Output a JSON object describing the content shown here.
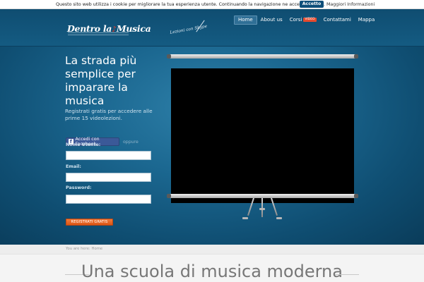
{
  "cookie_bar": {
    "message": "Questo sito web utilizza i cookie per migliorare la tua esperienza utente. Continuando la navigazione ne accetti l'utilizzo.",
    "accept_label": "Accetto",
    "more_label": "Maggiori Informazioni"
  },
  "header": {
    "logo_text_1": "Dentro la",
    "logo_note": "♪",
    "logo_text_2": "Musica",
    "tagline": "Lezioni con Skype"
  },
  "nav": {
    "items": [
      {
        "label": "Home",
        "active": true
      },
      {
        "label": "About us"
      },
      {
        "label": "Corsi",
        "badge": "VIDEO"
      },
      {
        "label": "Contattami"
      },
      {
        "label": "Mappa"
      }
    ]
  },
  "hero": {
    "headline": "La strada più semplice per imparare la musica",
    "subline": "Registrati gratis per accedere alle prime 15 videolezioni.",
    "facebook_label": "Accedi con Facebook",
    "facebook_icon": "f",
    "or_label": "oppure",
    "fields": {
      "username_label": "Nome Utente:",
      "email_label": "Email:",
      "password_label": "Password:"
    },
    "register_label": "REGISTRATI GRATIS"
  },
  "breadcrumb": "You are here: Home",
  "section_title": "Una scuola di musica moderna"
}
